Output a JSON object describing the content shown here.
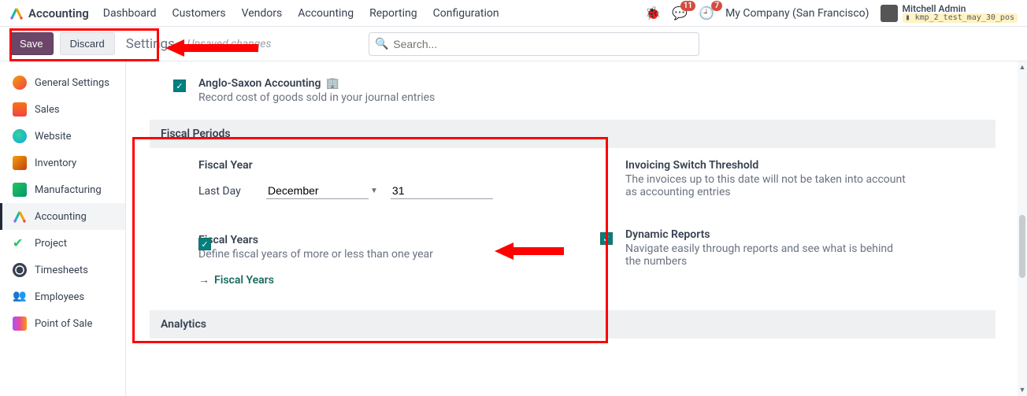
{
  "app": {
    "name": "Accounting",
    "menu": [
      "Dashboard",
      "Customers",
      "Vendors",
      "Accounting",
      "Reporting",
      "Configuration"
    ]
  },
  "header_right": {
    "messages_badge": "11",
    "activities_badge": "7",
    "company": "My Company (San Francisco)",
    "user": "Mitchell Admin",
    "db": "kmp_2_test_may_30_pos"
  },
  "actionbar": {
    "save": "Save",
    "discard": "Discard",
    "title": "Settings",
    "unsaved": "Unsaved changes",
    "search_placeholder": "Search..."
  },
  "sidebar": {
    "items": [
      {
        "label": "General Settings"
      },
      {
        "label": "Sales"
      },
      {
        "label": "Website"
      },
      {
        "label": "Inventory"
      },
      {
        "label": "Manufacturing"
      },
      {
        "label": "Accounting"
      },
      {
        "label": "Project"
      },
      {
        "label": "Timesheets"
      },
      {
        "label": "Employees"
      },
      {
        "label": "Point of Sale"
      }
    ]
  },
  "settings": {
    "anglo": {
      "title": "Anglo-Saxon Accounting",
      "sub": "Record cost of goods sold in your journal entries"
    },
    "fiscal_header": "Fiscal Periods",
    "fiscal_year": {
      "title": "Fiscal Year",
      "last_day_label": "Last Day",
      "month": "December",
      "day": "31"
    },
    "fiscal_years_opt": {
      "title": "Fiscal Years",
      "sub": "Define fiscal years of more or less than one year",
      "link": "Fiscal Years"
    },
    "threshold": {
      "title": "Invoicing Switch Threshold",
      "sub": "The invoices up to this date will not be taken into account as accounting entries"
    },
    "dynamic": {
      "title": "Dynamic Reports",
      "sub": "Navigate easily through reports and see what is behind the numbers"
    },
    "analytics_header": "Analytics"
  }
}
